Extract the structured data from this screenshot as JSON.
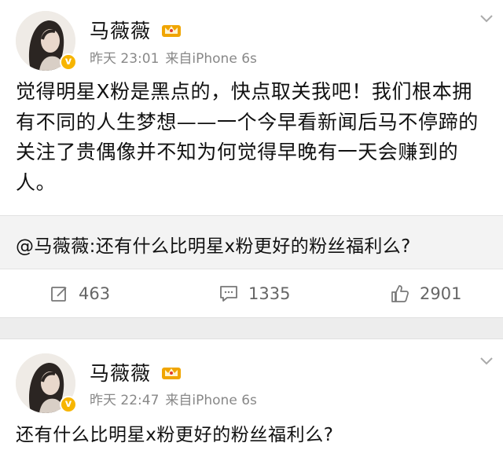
{
  "post1": {
    "author": "马薇薇",
    "time": "昨天 23:01",
    "source": "来自iPhone 6s",
    "text": "觉得明星X粉是黑点的，快点取关我吧！我们根本拥有不同的人生梦想——一个今早看新闻后马不停蹄的关注了贵偶像并不知为何觉得早晚有一天会赚到的人。",
    "repost_text": "@马薇薇:还有什么比明星x粉更好的粉丝福利么?",
    "actions": {
      "repost_count": "463",
      "comment_count": "1335",
      "like_count": "2901"
    }
  },
  "post2": {
    "author": "马薇薇",
    "time": "昨天 22:47",
    "source": "来自iPhone 6s",
    "text": "还有什么比明星x粉更好的粉丝福利么?"
  },
  "icons": {
    "verified": "verified-badge-icon",
    "crown": "crown-member-icon",
    "repost": "edit-repost-icon",
    "comment": "comment-icon",
    "like": "thumbs-up-icon",
    "more": "chevron-down-icon"
  },
  "colors": {
    "text": "#111111",
    "meta": "#888888",
    "badge": "#f7b500",
    "crown": "#f0a500",
    "repost_bg": "#f3f3f3"
  }
}
